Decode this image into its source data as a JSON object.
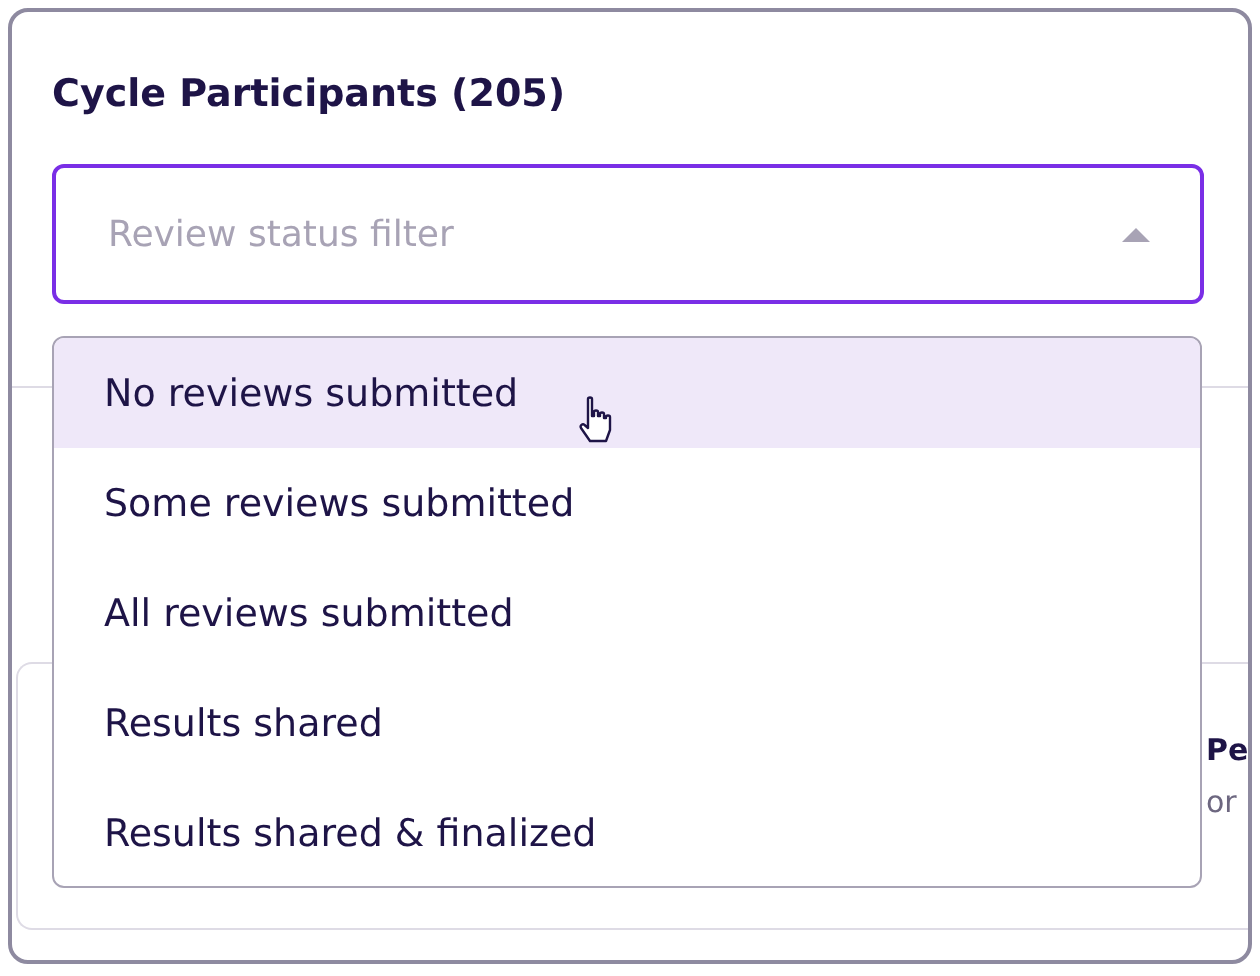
{
  "title": "Cycle Participants (205)",
  "filter": {
    "placeholder": "Review status filter",
    "expanded": true
  },
  "options": [
    {
      "label": "No reviews submitted",
      "selected": true
    },
    {
      "label": "Some reviews submitted",
      "selected": false
    },
    {
      "label": "All reviews submitted",
      "selected": false
    },
    {
      "label": "Results shared",
      "selected": false
    },
    {
      "label": "Results shared & finalized",
      "selected": false
    }
  ],
  "background_card": {
    "heading": "Pe",
    "text": "or"
  }
}
